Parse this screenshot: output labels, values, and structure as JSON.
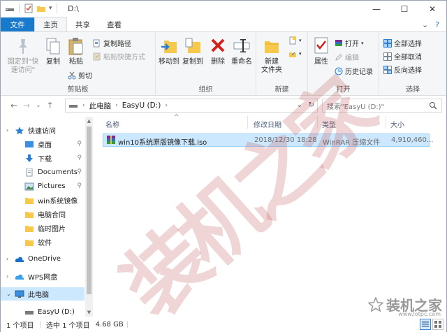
{
  "window": {
    "title": "D:\\",
    "controls": {
      "minimize": "—",
      "maximize": "☐",
      "close": "✕"
    }
  },
  "tabs": {
    "file": "文件",
    "home": "主页",
    "share": "共享",
    "view": "查看",
    "collapse": "⌄",
    "help": "?"
  },
  "ribbon": {
    "clipboard": {
      "group": "剪贴板",
      "pin_line1": "固定到\"快",
      "pin_line2": "速访问\"",
      "copy": "复制",
      "paste": "粘贴",
      "copy_path": "复制路径",
      "paste_shortcut": "粘贴快捷方式",
      "cut": "剪切"
    },
    "organize": {
      "group": "组织",
      "move_to": "移动到",
      "copy_to": "复制到",
      "delete": "删除",
      "rename": "重命名"
    },
    "new": {
      "group": "新建",
      "new_folder_line1": "新建",
      "new_folder_line2": "文件夹"
    },
    "open": {
      "group": "打开",
      "properties": "属性",
      "open": "打开",
      "edit": "编辑",
      "history": "历史记录"
    },
    "select": {
      "group": "选择",
      "select_all": "全部选择",
      "select_none": "全部取消",
      "invert": "反向选择"
    }
  },
  "address": {
    "back": "←",
    "forward": "→",
    "recent": "⌄",
    "up": "↑",
    "crumb1": "此电脑",
    "crumb2": "EasyU (D:)",
    "sep": "›",
    "dropdown": "⌄",
    "refresh": "↻",
    "search_placeholder": "搜索\"EasyU (D:)\""
  },
  "nav": {
    "items": [
      {
        "label": "快速访问"
      },
      {
        "label": "桌面"
      },
      {
        "label": "下载"
      },
      {
        "label": "Documents"
      },
      {
        "label": "Pictures"
      },
      {
        "label": "win系统镜像"
      },
      {
        "label": "电脑合同"
      },
      {
        "label": "临时图片"
      },
      {
        "label": "软件"
      },
      {
        "label": "OneDrive"
      },
      {
        "label": "WPS网盘"
      },
      {
        "label": "此电脑"
      },
      {
        "label": "EasyU (D:)"
      }
    ],
    "pin": "⚲"
  },
  "columns": {
    "name": "名称",
    "date": "修改日期",
    "type": "类型",
    "size": "大小",
    "sort_indicator": "^"
  },
  "files": [
    {
      "name": "win10系统原版镜像下载.iso",
      "date": "2018/12/30 18:28",
      "type": "WinRAR 压缩文件",
      "size": "4,910,460..."
    }
  ],
  "status": {
    "count": "1 个项目",
    "selected": "选中 1 个项目",
    "size": "4.68 GB"
  },
  "watermark": {
    "text": "装机之家",
    "logo_text": "装机之家",
    "logo_url": "www.lotpc.com"
  }
}
